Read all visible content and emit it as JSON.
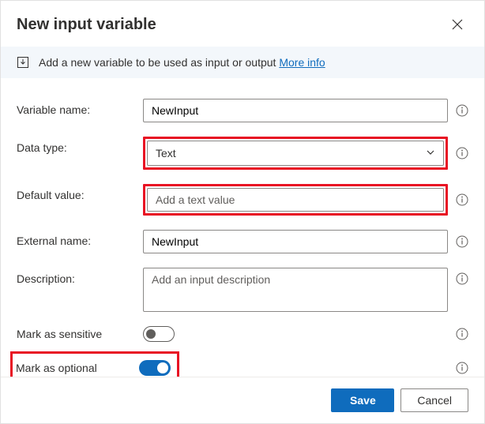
{
  "header": {
    "title": "New input variable"
  },
  "banner": {
    "text": "Add a new variable to be used as input or output ",
    "link_label": "More info"
  },
  "form": {
    "variable_name": {
      "label": "Variable name:",
      "value": "NewInput"
    },
    "data_type": {
      "label": "Data type:",
      "value": "Text"
    },
    "default_value": {
      "label": "Default value:",
      "placeholder": "Add a text value"
    },
    "external_name": {
      "label": "External name:",
      "value": "NewInput"
    },
    "description": {
      "label": "Description:",
      "placeholder": "Add an input description"
    },
    "sensitive": {
      "label": "Mark as sensitive",
      "value": false
    },
    "optional": {
      "label": "Mark as optional",
      "value": true
    }
  },
  "footer": {
    "save": "Save",
    "cancel": "Cancel"
  }
}
